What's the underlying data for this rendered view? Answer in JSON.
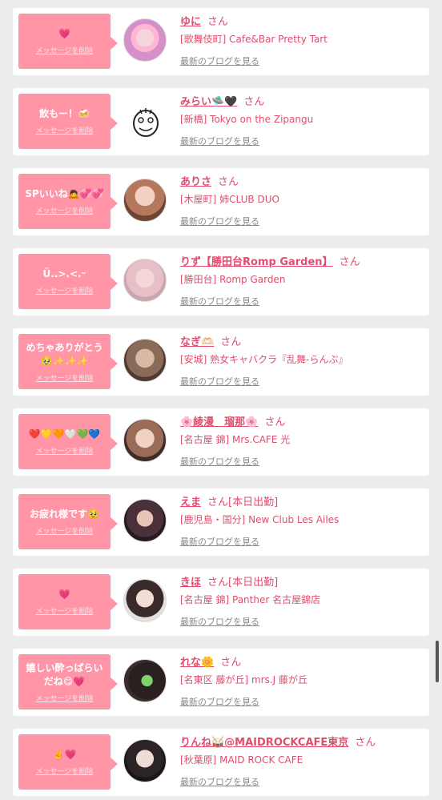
{
  "delete_label": "メッセージを削除",
  "blog_label": "最新のブログを見る",
  "san": "さん",
  "cards": [
    {
      "message": "💗",
      "name": "ゆに",
      "status": "",
      "shop": "[歌舞伎町] Cafe&Bar Pretty Tart",
      "avatar": "pink-hair-girl"
    },
    {
      "message": "飲もー！🍻",
      "name": "みらい🛸🖤",
      "status": "",
      "shop": "[新橋] Tokyo on the Zipangu",
      "avatar": "face-doodle"
    },
    {
      "message": "SPいいね🙇💞💞",
      "name": "ありさ",
      "status": "",
      "shop": "[木屋町] 姉CLUB DUO",
      "avatar": "girl-photo"
    },
    {
      "message": "Ü..>.<.ᵕ",
      "name": "りず【勝田台Romp Garden】",
      "status": "",
      "shop": "[勝田台] Romp Garden",
      "avatar": "girl-photo"
    },
    {
      "message": "めちゃありがとう🥹✨✨✨",
      "name": "なぎ🫶🏻",
      "status": "",
      "shop": "[安城] 熟女キャバクラ『乱舞-らんぶ』",
      "avatar": "girl-photo"
    },
    {
      "message": "❤️💛🧡🤍💚💙",
      "name": "🌸綾漫　瑠那🌸",
      "status": "",
      "shop": "[名古屋 錦] Mrs.CAFE 光",
      "avatar": "girl-photo"
    },
    {
      "message": "お疲れ様です🥹",
      "name": "えま",
      "status": "[本日出勤]",
      "shop": "[鹿児島・国分] New Club Les Ailes",
      "avatar": "girl-photo"
    },
    {
      "message": "💗",
      "name": "きほ",
      "status": "[本日出勤]",
      "shop": "[名古屋 錦] Panther 名古屋錦店",
      "avatar": "girl-photo"
    },
    {
      "message": "嬉しい酔っぱらいだね😋💗",
      "name": "れな🌼",
      "status": "",
      "shop": "[名東区 藤が丘] mrs.J 藤が丘",
      "avatar": "girl-photo"
    },
    {
      "message": "✌️💗",
      "name": "りんね🥁@MAIDROCKCAFE東京",
      "status": "",
      "shop": "[秋葉原] MAID ROCK CAFE",
      "avatar": "girl-photo"
    }
  ]
}
